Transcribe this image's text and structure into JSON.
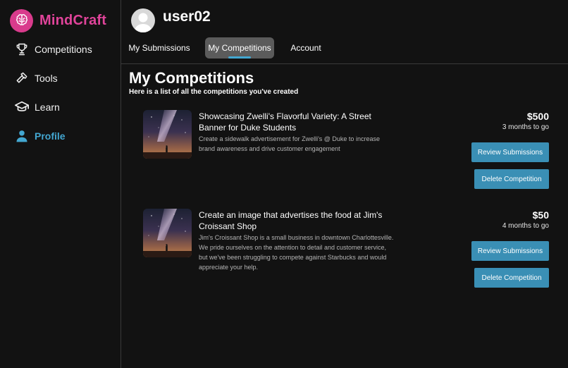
{
  "brand": {
    "name": "MindCraft",
    "color": "#e0449a"
  },
  "sidebar": {
    "items": [
      {
        "label": "Competitions",
        "icon": "trophy-icon"
      },
      {
        "label": "Tools",
        "icon": "hammer-icon"
      },
      {
        "label": "Learn",
        "icon": "graduation-cap-icon"
      },
      {
        "label": "Profile",
        "icon": "user-icon",
        "active": true
      }
    ],
    "active_color": "#43a7d1"
  },
  "header": {
    "username": "user02",
    "tabs": [
      {
        "label": "My Submissions"
      },
      {
        "label": "My Competitions",
        "active": true
      },
      {
        "label": "Account"
      }
    ]
  },
  "main": {
    "title": "My Competitions",
    "subtitle": "Here is a list of all the competitions you've created",
    "competitions": [
      {
        "title": "Showcasing Zwelli's Flavorful Variety: A Street Banner for Duke Students",
        "description": "Create a sidewalk advertisement for Zwelli's @ Duke to increase brand awareness and drive customer engagement",
        "prize": "$500",
        "deadline": "3 months to go",
        "review_label": "Review Submissions",
        "delete_label": "Delete Competition"
      },
      {
        "title": "Create an image that advertises the food at Jim's Croissant Shop",
        "description": "Jim's Croissant Shop is a small business in downtown Charlottesville. We pride ourselves on the attention to detail and customer service, but we've been struggling to compete against Starbucks and would appreciate your help.",
        "prize": "$50",
        "deadline": "4 months to go",
        "review_label": "Review Submissions",
        "delete_label": "Delete Competition"
      }
    ]
  },
  "colors": {
    "button": "#3a8fb5",
    "background": "#121212"
  }
}
